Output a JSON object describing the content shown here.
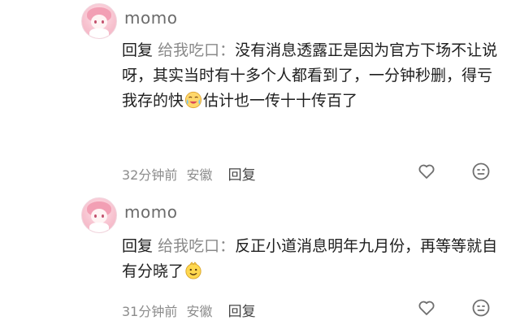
{
  "comments": [
    {
      "username": "momo",
      "reply_label": "回复",
      "reply_target": "给我吃口：",
      "text_part1": "没有消息透露正是因为官方下场不让说呀，其实当时有十多个人都看到了，一分钟秒删，得亏我存的快",
      "text_part2": "估计也一传十十传百了",
      "emoji": "crying-laughing-emoji",
      "time": "32分钟前",
      "location": "安徽",
      "reply_button": "回复",
      "like_icon": "heart-icon",
      "dislike_icon": "neutral-face-icon"
    },
    {
      "username": "momo",
      "reply_label": "回复",
      "reply_target": "给我吃口：",
      "text_part1": "反正小道消息明年九月份，再等等就自有分晓了",
      "text_part2": "",
      "emoji": "sly-smile-emoji",
      "time": "31分钟前",
      "location": "安徽",
      "reply_button": "回复",
      "like_icon": "heart-icon",
      "dislike_icon": "neutral-face-icon"
    }
  ],
  "colors": {
    "username": "#6b6b6b",
    "text": "#1e1e1e",
    "target": "#8a8a8a",
    "meta": "#8c8c8c",
    "icon": "#6f6f6f"
  }
}
